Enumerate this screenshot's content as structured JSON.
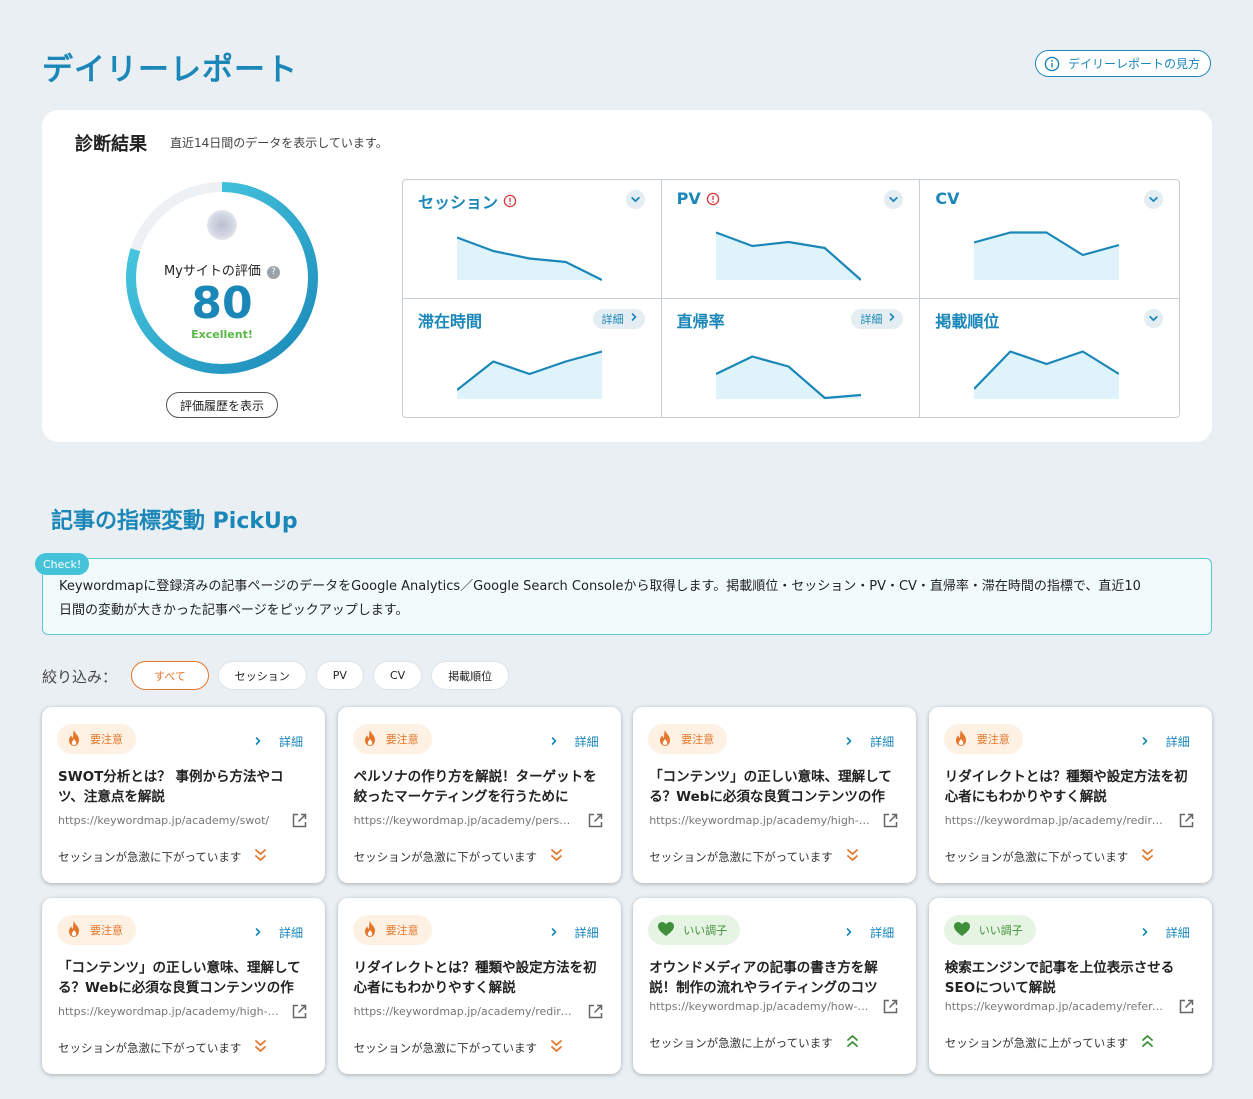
{
  "page": {
    "title": "デイリーレポート",
    "guide_button": "デイリーレポートの見方"
  },
  "diagnosis": {
    "title": "診断結果",
    "subtitle": "直近14日間のデータを表示しています。",
    "gauge": {
      "label": "Myサイトの評価",
      "help_icon": "?",
      "score": "80",
      "grade": "Excellent!",
      "score_fraction": 0.8
    },
    "history_button": "評価履歴を表示",
    "metrics": [
      {
        "name": "セッション",
        "warning": true,
        "action": "chevron",
        "trend": [
          0.15,
          0.42,
          0.57,
          0.64,
          1.0
        ]
      },
      {
        "name": "PV",
        "warning": true,
        "action": "chevron",
        "trend": [
          0.05,
          0.32,
          0.24,
          0.36,
          1.0
        ]
      },
      {
        "name": "CV",
        "warning": false,
        "action": "chevron",
        "trend": [
          0.25,
          0.05,
          0.05,
          0.5,
          0.3
        ]
      },
      {
        "name": "滞在時間",
        "warning": false,
        "action": "detail",
        "detail_label": "詳細",
        "trend": [
          0.82,
          0.25,
          0.5,
          0.25,
          0.05
        ]
      },
      {
        "name": "直帰率",
        "warning": false,
        "action": "detail",
        "detail_label": "詳細",
        "trend": [
          0.5,
          0.15,
          0.35,
          0.98,
          0.92
        ]
      },
      {
        "name": "掲載順位",
        "warning": false,
        "action": "chevron",
        "trend": [
          0.8,
          0.05,
          0.3,
          0.05,
          0.5
        ]
      }
    ],
    "colors": {
      "accent": "#1a87b8",
      "gauge_start": "#4ed3e6",
      "gauge_end": "#1a87b8",
      "spark_fill": "#dff3fa"
    }
  },
  "pickup": {
    "title": "記事の指標変動 PickUp",
    "check_badge": "Check!",
    "check_line1": "Keywordmapに登録済みの記事ページのデータをGoogle Analytics／Google Search Consoleから取得します。掲載順位・セッション・PV・CV・直帰率・滞在時間の指標で、直近10",
    "check_line2": "日間の変動が大きかった記事ページをピックアップします。",
    "filter_label": "絞り込み：",
    "filters": [
      "すべて",
      "セッション",
      "PV",
      "CV",
      "掲載順位"
    ],
    "cards": [
      {
        "status": "要注意",
        "type": "warn",
        "detail": "詳細",
        "title": "SWOT分析とは？ 事例から方法やコツ、注意点を解説",
        "url": "https://keywordmap.jp/academy/swot/",
        "change": "セッションが急激に下がっています",
        "direction": "down"
      },
      {
        "status": "要注意",
        "type": "warn",
        "detail": "詳細",
        "title": "ペルソナの作り方を解説！ターゲットを絞ったマーケティングを行うために",
        "url": "https://keywordmap.jp/academy/persona/",
        "change": "セッションが急激に下がっています",
        "direction": "down"
      },
      {
        "status": "要注意",
        "type": "warn",
        "detail": "詳細",
        "title": "「コンテンツ」の正しい意味、理解してる？Webに必須な良質コンテンツの作り方",
        "url": "https://keywordmap.jp/academy/high-quality-contents/",
        "change": "セッションが急激に下がっています",
        "direction": "down"
      },
      {
        "status": "要注意",
        "type": "warn",
        "detail": "詳細",
        "title": "リダイレクトとは？種類や設定方法を初心者にもわかりやすく解説",
        "url": "https://keywordmap.jp/academy/redirect/",
        "change": "セッションが急激に下がっています",
        "direction": "down"
      },
      {
        "status": "要注意",
        "type": "warn",
        "detail": "詳細",
        "title": "「コンテンツ」の正しい意味、理解してる？Webに必須な良質コンテンツの作り方",
        "url": "https://keywordmap.jp/academy/high-quality-contents/",
        "change": "セッションが急激に下がっています",
        "direction": "down"
      },
      {
        "status": "要注意",
        "type": "warn",
        "detail": "詳細",
        "title": "リダイレクトとは？種類や設定方法を初心者にもわかりやすく解説",
        "url": "https://keywordmap.jp/academy/redirect/",
        "change": "セッションが急激に下がっています",
        "direction": "down"
      },
      {
        "status": "いい調子",
        "type": "good",
        "detail": "詳細",
        "title": "オウンドメディアの記事の書き方を解説！制作の流れやライティングのコツ",
        "url": "https://keywordmap.jp/academy/how-to-write-articles/",
        "change": "セッションが急激に上がっています",
        "direction": "up"
      },
      {
        "status": "いい調子",
        "type": "good",
        "detail": "詳細",
        "title": "検索エンジンで記事を上位表示させるSEOについて解説",
        "url": "https://keywordmap.jp/academy/refer-to-seo/",
        "change": "セッションが急激に上がっています",
        "direction": "up"
      }
    ]
  }
}
